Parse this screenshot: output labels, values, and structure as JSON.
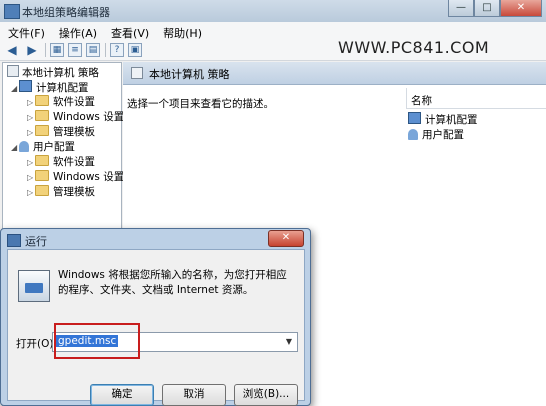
{
  "window": {
    "title": "本地组策略编辑器",
    "controls": [
      "—",
      "□",
      "✕"
    ]
  },
  "menu": [
    "文件(F)",
    "操作(A)",
    "查看(V)",
    "帮助(H)"
  ],
  "toolbar_icons": [
    "back-arrow-icon",
    "forward-arrow-icon",
    "panel-icon",
    "list-icon",
    "properties-icon",
    "help-icon",
    "view-icon"
  ],
  "watermark": "WWW.PC841.COM",
  "tree": {
    "root": "本地计算机 策略",
    "computer": "计算机配置",
    "computer_children": [
      "软件设置",
      "Windows 设置",
      "管理模板"
    ],
    "user": "用户配置",
    "user_children": [
      "软件设置",
      "Windows 设置",
      "管理模板"
    ]
  },
  "right_panel": {
    "header": "本地计算机 策略",
    "description": "选择一个项目来查看它的描述。",
    "column": "名称",
    "items": [
      "计算机配置",
      "用户配置"
    ]
  },
  "run_dialog": {
    "title": "运行",
    "close": "✕",
    "description": "Windows 将根据您所输入的名称，为您打开相应的程序、文件夹、文档或 Internet 资源。",
    "open_label": "打开(O):",
    "open_value": "gpedit.msc",
    "ok": "确定",
    "cancel": "取消",
    "browse": "浏览(B)..."
  }
}
